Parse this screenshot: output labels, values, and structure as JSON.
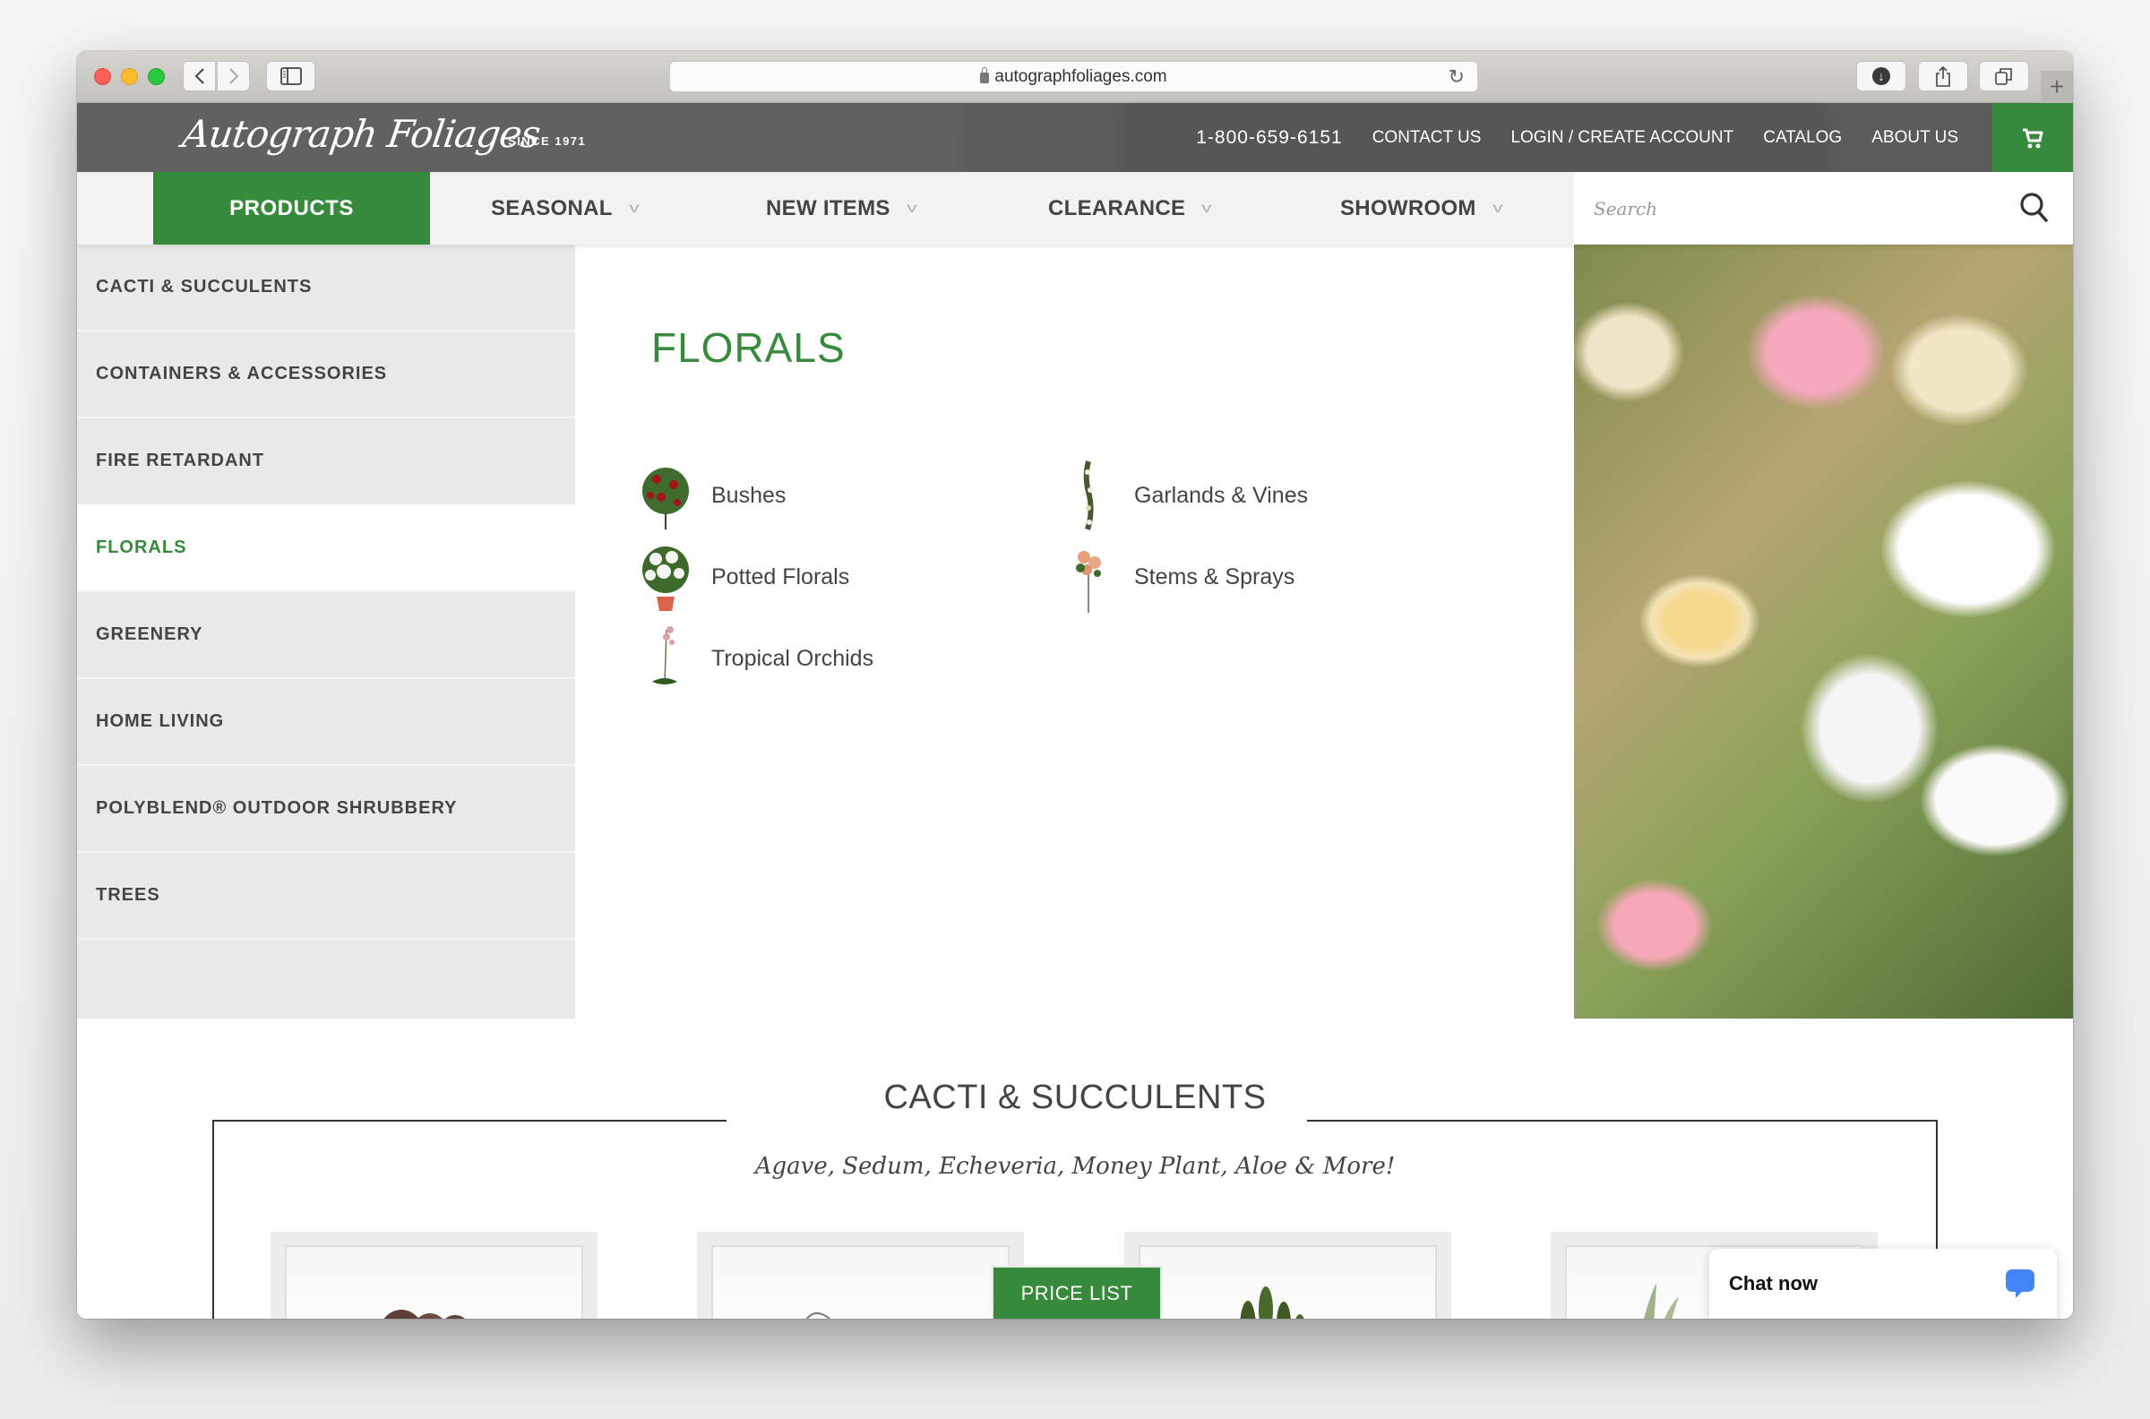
{
  "browser": {
    "url": "autographfoliages.com",
    "back_icon": "chevron-left-icon",
    "forward_icon": "chevron-right-icon",
    "new_tab_label": "+"
  },
  "header": {
    "logo": "Autograph Foliages",
    "since": "SINCE 1971",
    "phone": "1-800-659-6151",
    "links": [
      "CONTACT US",
      "LOGIN / CREATE ACCOUNT",
      "CATALOG",
      "ABOUT US"
    ],
    "cart_icon": "cart-icon"
  },
  "nav": {
    "products": "PRODUCTS",
    "items": [
      {
        "label": "SEASONAL"
      },
      {
        "label": "NEW ITEMS"
      },
      {
        "label": "CLEARANCE"
      },
      {
        "label": "SHOWROOM"
      }
    ],
    "search_placeholder": "Search"
  },
  "sidebar": {
    "items": [
      {
        "label": "CACTI & SUCCULENTS"
      },
      {
        "label": "CONTAINERS & ACCESSORIES"
      },
      {
        "label": "FIRE RETARDANT"
      },
      {
        "label": "FLORALS",
        "active": true
      },
      {
        "label": "GREENERY"
      },
      {
        "label": "HOME LIVING"
      },
      {
        "label": "POLYBLEND® OUTDOOR SHRUBBERY"
      },
      {
        "label": "TREES"
      }
    ]
  },
  "menu": {
    "title": "FLORALS",
    "subcategories": [
      {
        "label": "Bushes"
      },
      {
        "label": "Potted Florals"
      },
      {
        "label": "Tropical Orchids"
      },
      {
        "label": "Garlands & Vines"
      },
      {
        "label": "Stems & Sprays"
      }
    ]
  },
  "section": {
    "title": "CACTI & SUCCULENTS",
    "subtitle": "Agave, Sedum, Echeveria, Money Plant, Aloe & More!"
  },
  "price_list": "PRICE LIST",
  "chat": {
    "label": "Chat now"
  },
  "colors": {
    "brand_green": "#378a3b",
    "header_gray": "#5b5b5b",
    "chat_blue": "#4285f4"
  }
}
